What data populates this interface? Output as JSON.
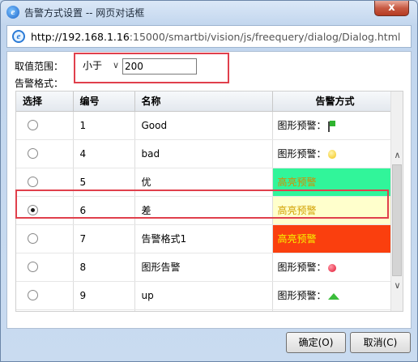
{
  "window": {
    "title": "告警方式设置 -- 网页对话框",
    "close_label": "x",
    "app_icon": "e-icon"
  },
  "address": {
    "host": "http://192.168.1.16",
    "path": ":15000/smartbi/vision/js/freequery/dialog/Dialog.html"
  },
  "filter": {
    "range_label": "取值范围：",
    "format_label": "告警格式：",
    "operator_value": "小于",
    "threshold_value": "200"
  },
  "table": {
    "headers": [
      "选择",
      "编号",
      "名称",
      "告警方式"
    ],
    "rows": [
      {
        "selected": false,
        "id": "1",
        "name": "Good",
        "alert": "图形预警：",
        "icon": "green-flag-icon",
        "style": "graphic"
      },
      {
        "selected": false,
        "id": "4",
        "name": "bad",
        "alert": "图形预警：",
        "icon": "lightbulb-icon",
        "style": "graphic"
      },
      {
        "selected": false,
        "id": "5",
        "name": "优",
        "alert": "高亮预警",
        "icon": "",
        "style": "green"
      },
      {
        "selected": true,
        "id": "6",
        "name": "差",
        "alert": "高亮预警",
        "icon": "",
        "style": "yellow"
      },
      {
        "selected": false,
        "id": "7",
        "name": "告警格式1",
        "alert": "高亮预警",
        "icon": "",
        "style": "red"
      },
      {
        "selected": false,
        "id": "8",
        "name": "图形告警",
        "alert": "图形预警：",
        "icon": "red-pin-icon",
        "style": "graphic"
      },
      {
        "selected": false,
        "id": "9",
        "name": "up",
        "alert": "图形预警：",
        "icon": "green-up-arrow-icon",
        "style": "graphic"
      }
    ]
  },
  "buttons": {
    "ok": "确定(O)",
    "cancel": "取消(C)"
  },
  "colors": {
    "highlight_green": "#31f59a",
    "highlight_yellow": "#ffffcc",
    "highlight_red": "#fa3f0e",
    "annotation_red": "#e0404c"
  }
}
